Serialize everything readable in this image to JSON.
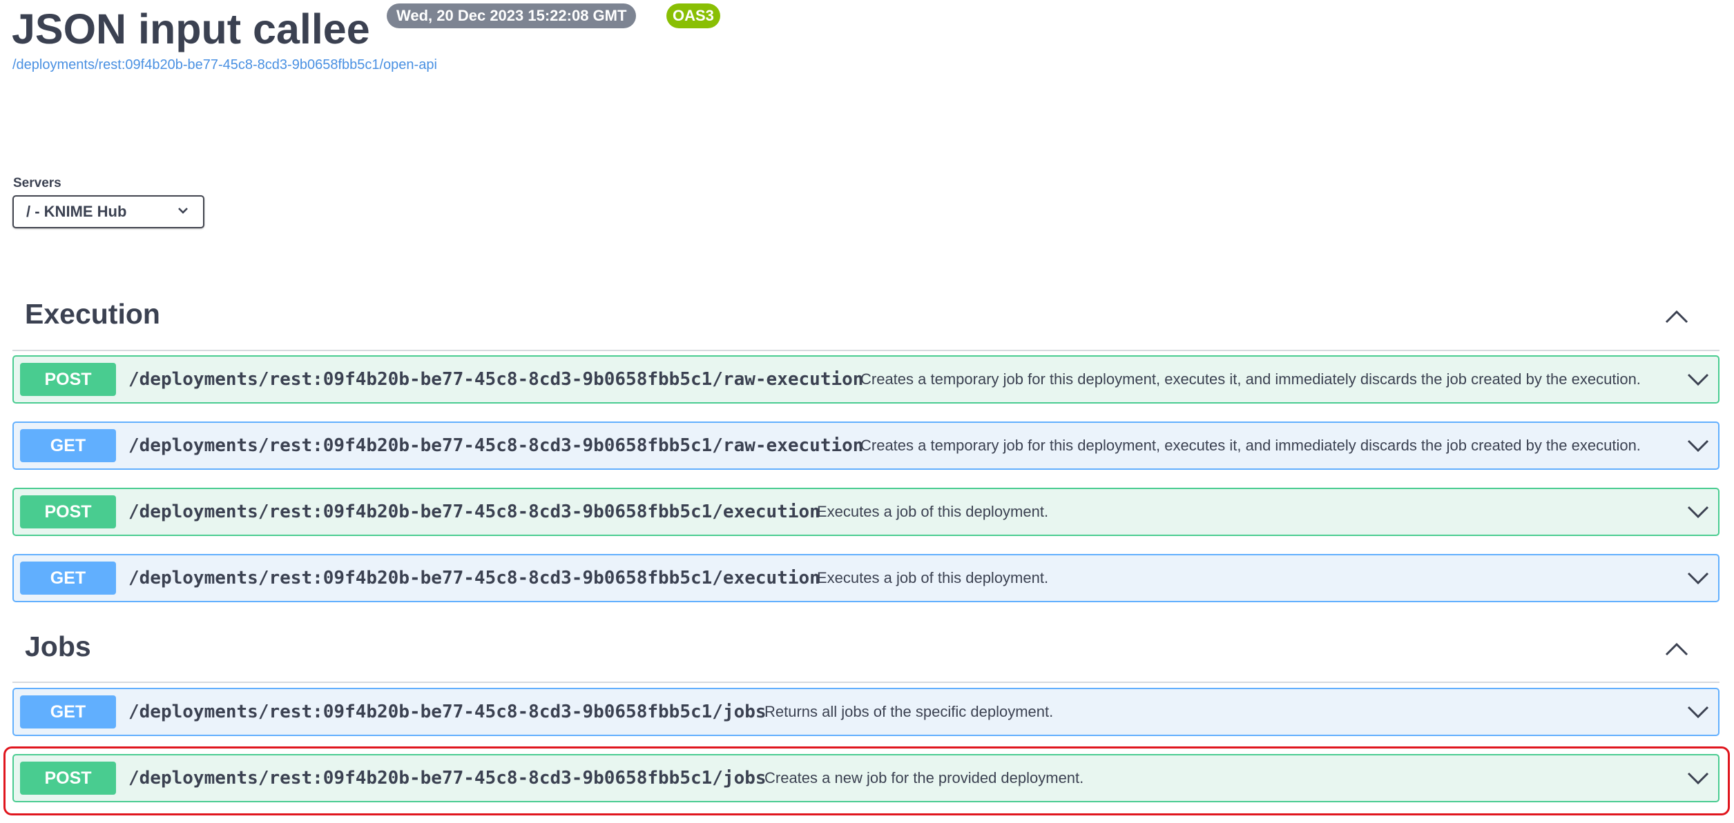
{
  "header": {
    "title": "JSON input callee",
    "version_badge": "Wed, 20 Dec 2023 15:22:08 GMT",
    "oas_badge": "OAS3",
    "spec_link": "/deployments/rest:09f4b20b-be77-45c8-8cd3-9b0658fbb5c1/open-api"
  },
  "servers": {
    "label": "Servers",
    "selected": "/ - KNIME Hub"
  },
  "sections": [
    {
      "title": "Execution",
      "operations": [
        {
          "method": "POST",
          "path": "/deployments/rest:09f4b20b-be77-45c8-8cd3-9b0658fbb5c1/raw-execution",
          "summary": "Creates a temporary job for this deployment, executes it, and immediately discards the job created by the execution."
        },
        {
          "method": "GET",
          "path": "/deployments/rest:09f4b20b-be77-45c8-8cd3-9b0658fbb5c1/raw-execution",
          "summary": "Creates a temporary job for this deployment, executes it, and immediately discards the job created by the execution."
        },
        {
          "method": "POST",
          "path": "/deployments/rest:09f4b20b-be77-45c8-8cd3-9b0658fbb5c1/execution",
          "summary": "Executes a job of this deployment."
        },
        {
          "method": "GET",
          "path": "/deployments/rest:09f4b20b-be77-45c8-8cd3-9b0658fbb5c1/execution",
          "summary": "Executes a job of this deployment."
        }
      ]
    },
    {
      "title": "Jobs",
      "operations": [
        {
          "method": "GET",
          "path": "/deployments/rest:09f4b20b-be77-45c8-8cd3-9b0658fbb5c1/jobs",
          "summary": "Returns all jobs of the specific deployment."
        },
        {
          "method": "POST",
          "path": "/deployments/rest:09f4b20b-be77-45c8-8cd3-9b0658fbb5c1/jobs",
          "summary": "Creates a new job for the provided deployment."
        }
      ]
    }
  ],
  "icons": {
    "collapse": "chevron-up-icon",
    "expand": "chevron-down-icon"
  },
  "colors": {
    "post": "#49cc90",
    "get": "#61affe",
    "highlight": "#e0161e"
  }
}
